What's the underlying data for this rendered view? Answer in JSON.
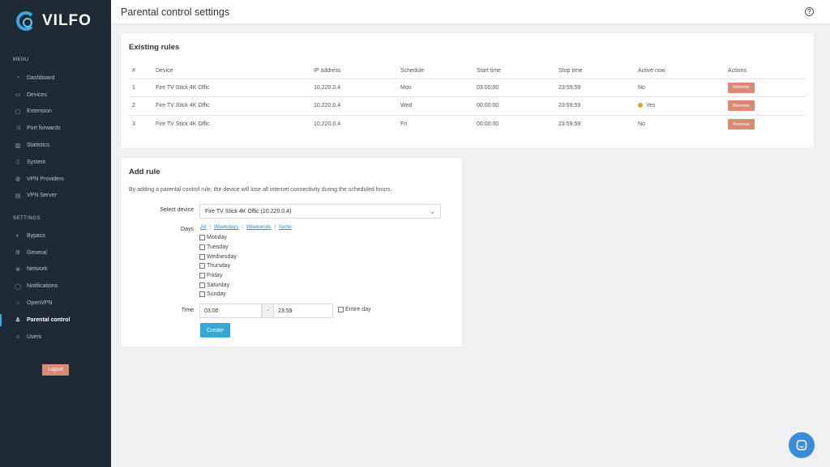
{
  "app": {
    "logo_text": "VILFO",
    "page_title": "Parental control settings",
    "accent": "#3fa7e0"
  },
  "sidebar": {
    "menu_label": "MENU",
    "menu_items": [
      {
        "label": "Dashboard",
        "icon": "gauge-icon"
      },
      {
        "label": "Devices",
        "icon": "devices-icon"
      },
      {
        "label": "Extension",
        "icon": "extension-icon"
      },
      {
        "label": "Port forwards",
        "icon": "shuffle-icon"
      },
      {
        "label": "Statistics",
        "icon": "chart-icon"
      },
      {
        "label": "System",
        "icon": "system-icon"
      },
      {
        "label": "VPN Providers",
        "icon": "vpn-icon"
      },
      {
        "label": "VPN Server",
        "icon": "server-icon"
      }
    ],
    "settings_label": "SETTINGS",
    "settings_items": [
      {
        "label": "Bypass",
        "icon": "bypass-icon"
      },
      {
        "label": "General",
        "icon": "gear-icon"
      },
      {
        "label": "Network",
        "icon": "network-icon"
      },
      {
        "label": "Notifications",
        "icon": "chat-icon"
      },
      {
        "label": "OpenVPN",
        "icon": "lock-icon"
      },
      {
        "label": "Parental control",
        "icon": "parental-icon",
        "active": true
      },
      {
        "label": "Users",
        "icon": "users-icon"
      }
    ],
    "logout_label": "Logout"
  },
  "existing_rules": {
    "title": "Existing rules",
    "columns": [
      "#",
      "Device",
      "IP address",
      "Schedule",
      "Start time",
      "Stop time",
      "Active now",
      "Actions"
    ],
    "rows": [
      {
        "num": "1",
        "device": "Fire TV Stick 4K Offic",
        "ip": "10.220.0.4",
        "schedule": "Mon",
        "start": "03:00:00",
        "stop": "23:59:59",
        "active": "No",
        "action": "Remove"
      },
      {
        "num": "2",
        "device": "Fire TV Stick 4K Offic",
        "ip": "10.220.0.4",
        "schedule": "Wed",
        "start": "00:00:00",
        "stop": "23:59:59",
        "active": "Yes",
        "action": "Remove"
      },
      {
        "num": "3",
        "device": "Fire TV Stick 4K Offic",
        "ip": "10.220.0.4",
        "schedule": "Fri",
        "start": "00:00:00",
        "stop": "23:59:59",
        "active": "No",
        "action": "Remove"
      }
    ]
  },
  "add_rule": {
    "title": "Add rule",
    "description": "By adding a parental control rule, the device will lose all internet connectivity during the scheduled hours.",
    "select_device_label": "Select device",
    "select_device_value": "Fire TV Stick 4K Offic (10.220.0.4)",
    "days_label": "Days",
    "day_links": [
      "All",
      "Weekdays",
      "Weekends",
      "None"
    ],
    "days": [
      "Monday",
      "Tuesday",
      "Wednesday",
      "Thursday",
      "Friday",
      "Saturday",
      "Sunday"
    ],
    "time_label": "Time",
    "time_start": "03:00",
    "time_sep": "-",
    "time_end": "23:59",
    "entire_day_label": "Entire day",
    "create_label": "Create"
  }
}
